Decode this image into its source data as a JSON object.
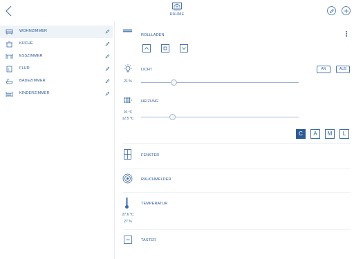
{
  "header": {
    "title": "RÄUME",
    "title_icon": "house-icon",
    "edit_icon": "pencil-icon",
    "add_icon": "plus-icon",
    "back_icon": "chevron-left-icon"
  },
  "sidebar": {
    "items": [
      {
        "label": "WOHNZIMMER",
        "icon": "sofa-icon",
        "active": true
      },
      {
        "label": "KÜCHE",
        "icon": "pot-icon"
      },
      {
        "label": "ESSZIMMER",
        "icon": "dining-table-icon"
      },
      {
        "label": "FLUR",
        "icon": "door-icon"
      },
      {
        "label": "BADEZIMMER",
        "icon": "bathtub-icon"
      },
      {
        "label": "KINDERZIMMER",
        "icon": "crib-icon"
      }
    ]
  },
  "devices": {
    "rollladen": {
      "label": "ROLLLADEN",
      "icon": "shutter-icon"
    },
    "licht": {
      "label": "LICHT",
      "icon": "lightbulb-icon",
      "value": "21 %",
      "level": 0.21,
      "on_label": "AN",
      "off_label": "AUS"
    },
    "heizung": {
      "label": "HEIZUNG",
      "icon": "radiator-icon",
      "setpoint": "20 °C",
      "current": "12.5 °C",
      "level": 0.2,
      "modes": [
        "C",
        "A",
        "M",
        "L"
      ],
      "active_mode": "C"
    },
    "fenster": {
      "label": "FENSTER",
      "icon": "window-icon"
    },
    "rauchmelder": {
      "label": "RAUCHMELDER",
      "icon": "smoke-detector-icon"
    },
    "temperatur": {
      "label": "TEMPERATUR",
      "icon": "thermometer-icon",
      "temperature": "27.6 °C",
      "humidity": "27 %"
    },
    "taster": {
      "label": "TASTER",
      "icon": "push-button-icon"
    }
  },
  "colors": {
    "accent": "#2c5b93",
    "active_row": "#eef3f8"
  }
}
